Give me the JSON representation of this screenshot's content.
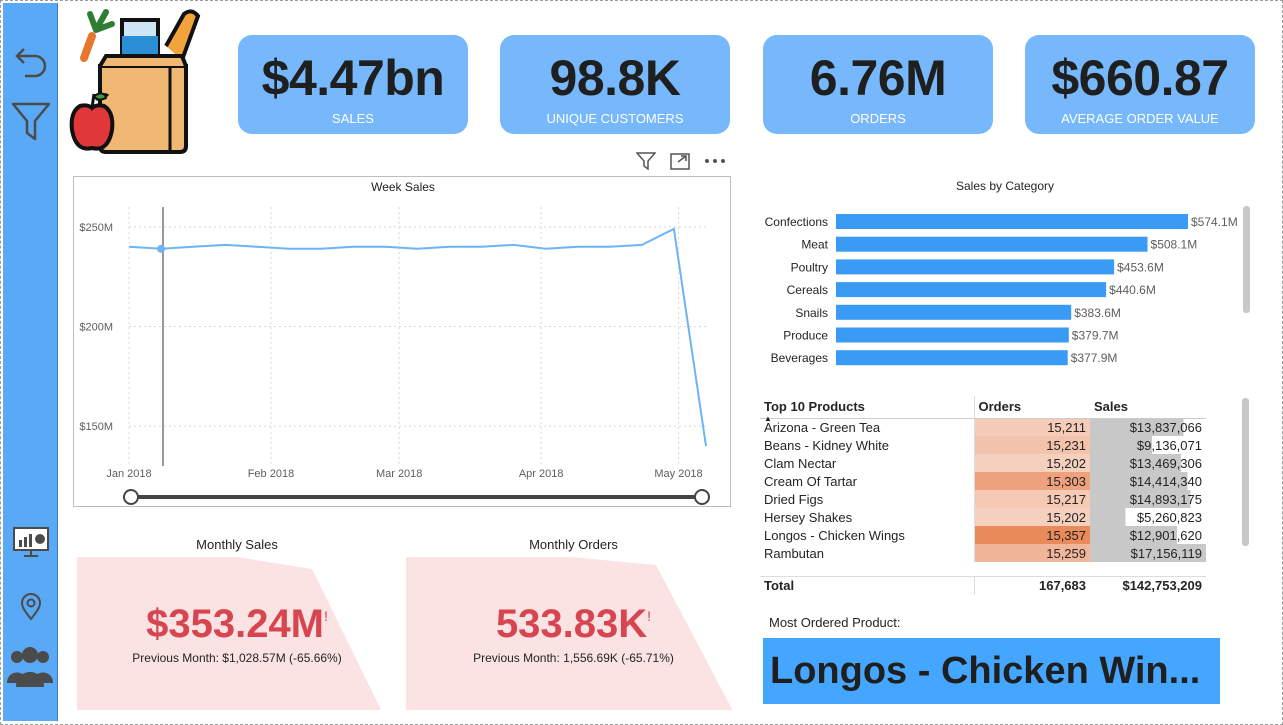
{
  "sidebar": {
    "items": [
      {
        "icon": "back-arrow-icon"
      },
      {
        "icon": "filter-icon"
      },
      {
        "icon": "presentation-chart-icon"
      },
      {
        "icon": "location-pin-icon"
      },
      {
        "icon": "users-group-icon"
      }
    ]
  },
  "kpis": [
    {
      "value": "$4.47bn",
      "label": "SALES"
    },
    {
      "value": "98.8K",
      "label": "UNIQUE CUSTOMERS"
    },
    {
      "value": "6.76M",
      "label": "ORDERS"
    },
    {
      "value": "$660.87",
      "label": "AVERAGE ORDER VALUE"
    }
  ],
  "colors": {
    "sidebar": "#5aa9f6",
    "kpi_bg": "#76b8fb",
    "bar": "#3a9bf4",
    "line": "#6cb4f5",
    "card_bg": "#fbe3e3",
    "card_value": "#d64550",
    "product_box": "#45a6ff"
  },
  "chart_data": [
    {
      "type": "line",
      "title": "Week Sales",
      "x_ticks": [
        "Jan 2018",
        "Feb 2018",
        "Mar 2018",
        "Apr 2018",
        "May 2018"
      ],
      "y_ticks": [
        "$150M",
        "$200M",
        "$250M"
      ],
      "ylim": [
        130,
        260
      ],
      "x": [
        "2018-01-01",
        "2018-01-08",
        "2018-01-15",
        "2018-01-22",
        "2018-01-29",
        "2018-02-05",
        "2018-02-12",
        "2018-02-19",
        "2018-02-26",
        "2018-03-05",
        "2018-03-12",
        "2018-03-19",
        "2018-03-26",
        "2018-04-02",
        "2018-04-09",
        "2018-04-16",
        "2018-04-23",
        "2018-04-30",
        "2018-05-07"
      ],
      "values": [
        240,
        239,
        240,
        241,
        240,
        239,
        239,
        240,
        240,
        239,
        240,
        240,
        241,
        239,
        240,
        240,
        241,
        249,
        140
      ],
      "grid": true
    },
    {
      "type": "bar",
      "title": "Sales by Category",
      "orientation": "horizontal",
      "categories": [
        "Confections",
        "Meat",
        "Poultry",
        "Cereals",
        "Snails",
        "Produce",
        "Beverages"
      ],
      "values": [
        574.1,
        508.1,
        453.6,
        440.6,
        383.6,
        379.7,
        377.9
      ],
      "labels": [
        "$574.1M",
        "$508.1M",
        "$453.6M",
        "$440.6M",
        "$383.6M",
        "$379.7M",
        "$377.9M"
      ],
      "xlim": [
        0,
        574.1
      ]
    }
  ],
  "week_tools": {
    "filter": "filter-icon",
    "focus": "focus-mode-icon",
    "more": "more-options-icon"
  },
  "top10": {
    "headers": [
      "Top 10 Products",
      "Orders",
      "Sales"
    ],
    "rows": [
      {
        "product": "Arizona - Green Tea",
        "orders": "15,211",
        "sales": "$13,837,066",
        "o": 15211,
        "s": 13837066
      },
      {
        "product": "Beans - Kidney White",
        "orders": "15,231",
        "sales": "$9,136,071",
        "o": 15231,
        "s": 9136071
      },
      {
        "product": "Clam Nectar",
        "orders": "15,202",
        "sales": "$13,469,306",
        "o": 15202,
        "s": 13469306
      },
      {
        "product": "Cream Of Tartar",
        "orders": "15,303",
        "sales": "$14,414,340",
        "o": 15303,
        "s": 14414340
      },
      {
        "product": "Dried Figs",
        "orders": "15,217",
        "sales": "$14,893,175",
        "o": 15217,
        "s": 14893175
      },
      {
        "product": "Hersey Shakes",
        "orders": "15,202",
        "sales": "$5,260,823",
        "o": 15202,
        "s": 5260823
      },
      {
        "product": "Longos - Chicken Wings",
        "orders": "15,357",
        "sales": "$12,901,620",
        "o": 15357,
        "s": 12901620
      },
      {
        "product": "Rambutan",
        "orders": "15,259",
        "sales": "$17,156,119",
        "o": 15259,
        "s": 17156119
      }
    ],
    "total_label": "Total",
    "total_orders": "167,683",
    "total_sales": "$142,753,209"
  },
  "monthly_sales": {
    "title": "Monthly Sales",
    "value": "$353.24M",
    "mark": "!",
    "sub": "Previous Month: $1,028.57M (-65.66%)"
  },
  "monthly_orders": {
    "title": "Monthly Orders",
    "value": "533.83K",
    "mark": "!",
    "sub": "Previous Month: 1,556.69K (-65.71%)"
  },
  "most_ordered": {
    "label": "Most Ordered Product:",
    "value": "Longos - Chicken Win..."
  }
}
